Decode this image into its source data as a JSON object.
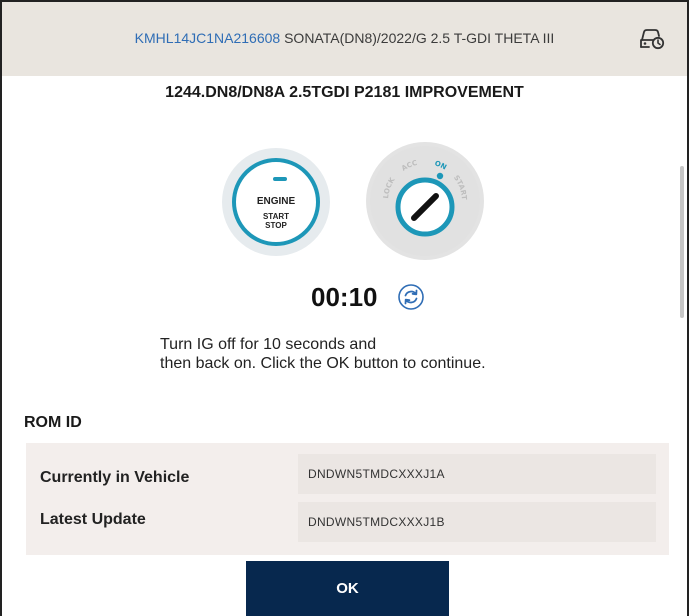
{
  "header": {
    "vin": "KMHL14JC1NA216608",
    "vehicle_desc": "SONATA(DN8)/2022/G 2.5 T-GDI THETA III",
    "icon": "car-settings-icon"
  },
  "procedure": {
    "title": "1244.DN8/DN8A 2.5TGDI P2181 IMPROVEMENT"
  },
  "start_button": {
    "line1": "ENGINE",
    "line2": "START",
    "line3": "STOP"
  },
  "ignition": {
    "positions": [
      "LOCK",
      "ACC",
      "ON",
      "START"
    ],
    "active": "ON",
    "accent": "#1d97b8"
  },
  "timer": {
    "value": "00:10",
    "icon": "refresh-icon"
  },
  "instruction": {
    "line1": "Turn IG off for 10 seconds and",
    "line2": "then back on. Click the OK button to continue."
  },
  "rom": {
    "title": "ROM ID",
    "rows": [
      {
        "label": "Currently in Vehicle",
        "value": "DNDWN5TMDCXXXJ1A"
      },
      {
        "label": "Latest Update",
        "value": "DNDWN5TMDCXXXJ1B"
      }
    ]
  },
  "actions": {
    "ok_label": "OK"
  },
  "colors": {
    "header_bg": "#e9e5df",
    "vin": "#2f6db5",
    "button": "#07284e"
  }
}
